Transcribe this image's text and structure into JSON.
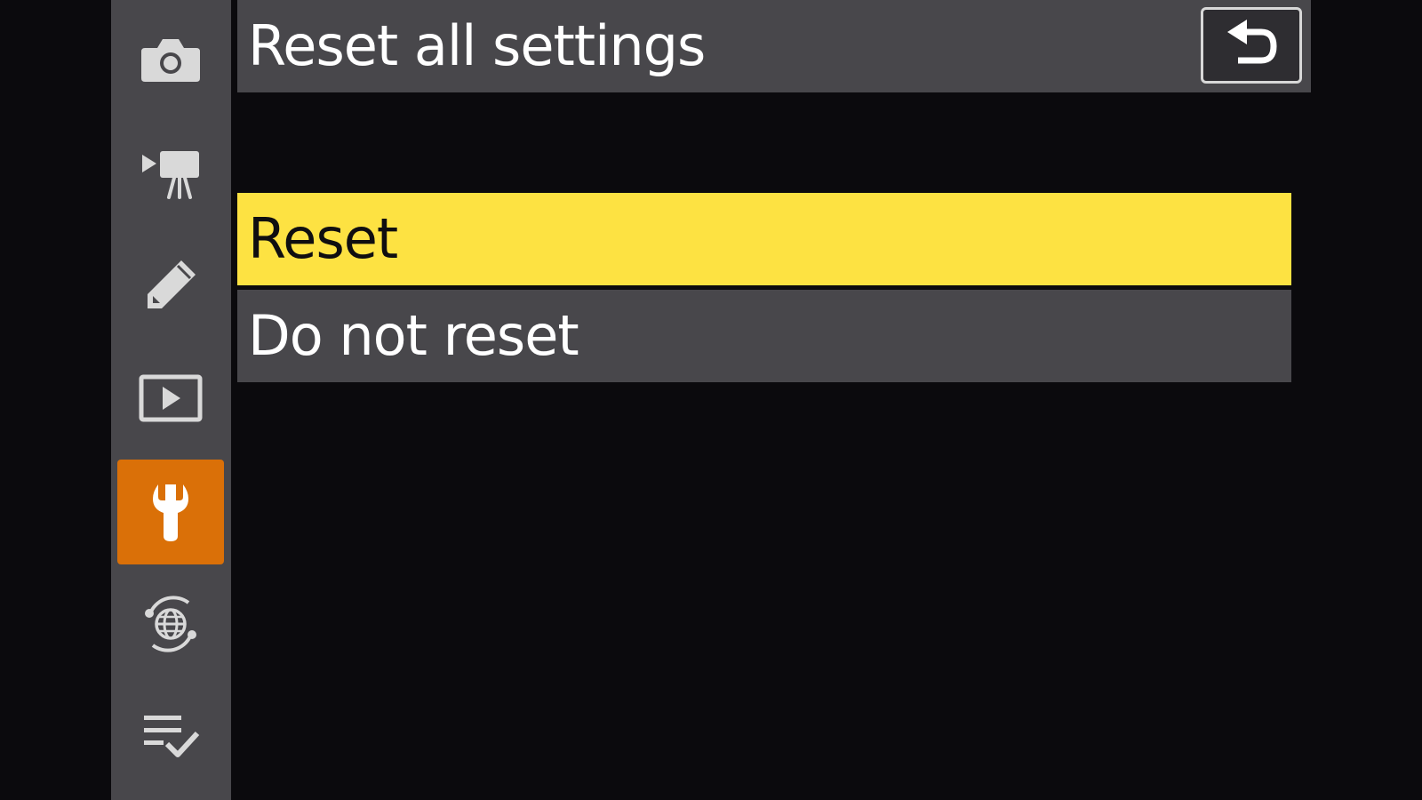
{
  "menu": {
    "title": "Reset all settings",
    "tabs": [
      {
        "name": "photo-shooting-menu",
        "icon": "camera-icon",
        "active": false
      },
      {
        "name": "video-recording-menu",
        "icon": "movie-camera-icon",
        "active": false
      },
      {
        "name": "custom-settings-menu",
        "icon": "pencil-icon",
        "active": false
      },
      {
        "name": "playback-menu",
        "icon": "play-icon",
        "active": false
      },
      {
        "name": "setup-menu",
        "icon": "wrench-icon",
        "active": true
      },
      {
        "name": "network-menu",
        "icon": "network-globe-icon",
        "active": false
      },
      {
        "name": "my-menu",
        "icon": "list-check-icon",
        "active": false
      }
    ],
    "back_icon": "return-arrow-icon",
    "options": [
      {
        "label": "Reset",
        "selected": true
      },
      {
        "label": "Do not reset",
        "selected": false
      }
    ]
  },
  "colors": {
    "background": "#0b0a0d",
    "panel": "#48474b",
    "highlight": "#fde242",
    "active_tab": "#da7008",
    "text": "#ffffff",
    "highlight_text": "#0f0e10"
  }
}
